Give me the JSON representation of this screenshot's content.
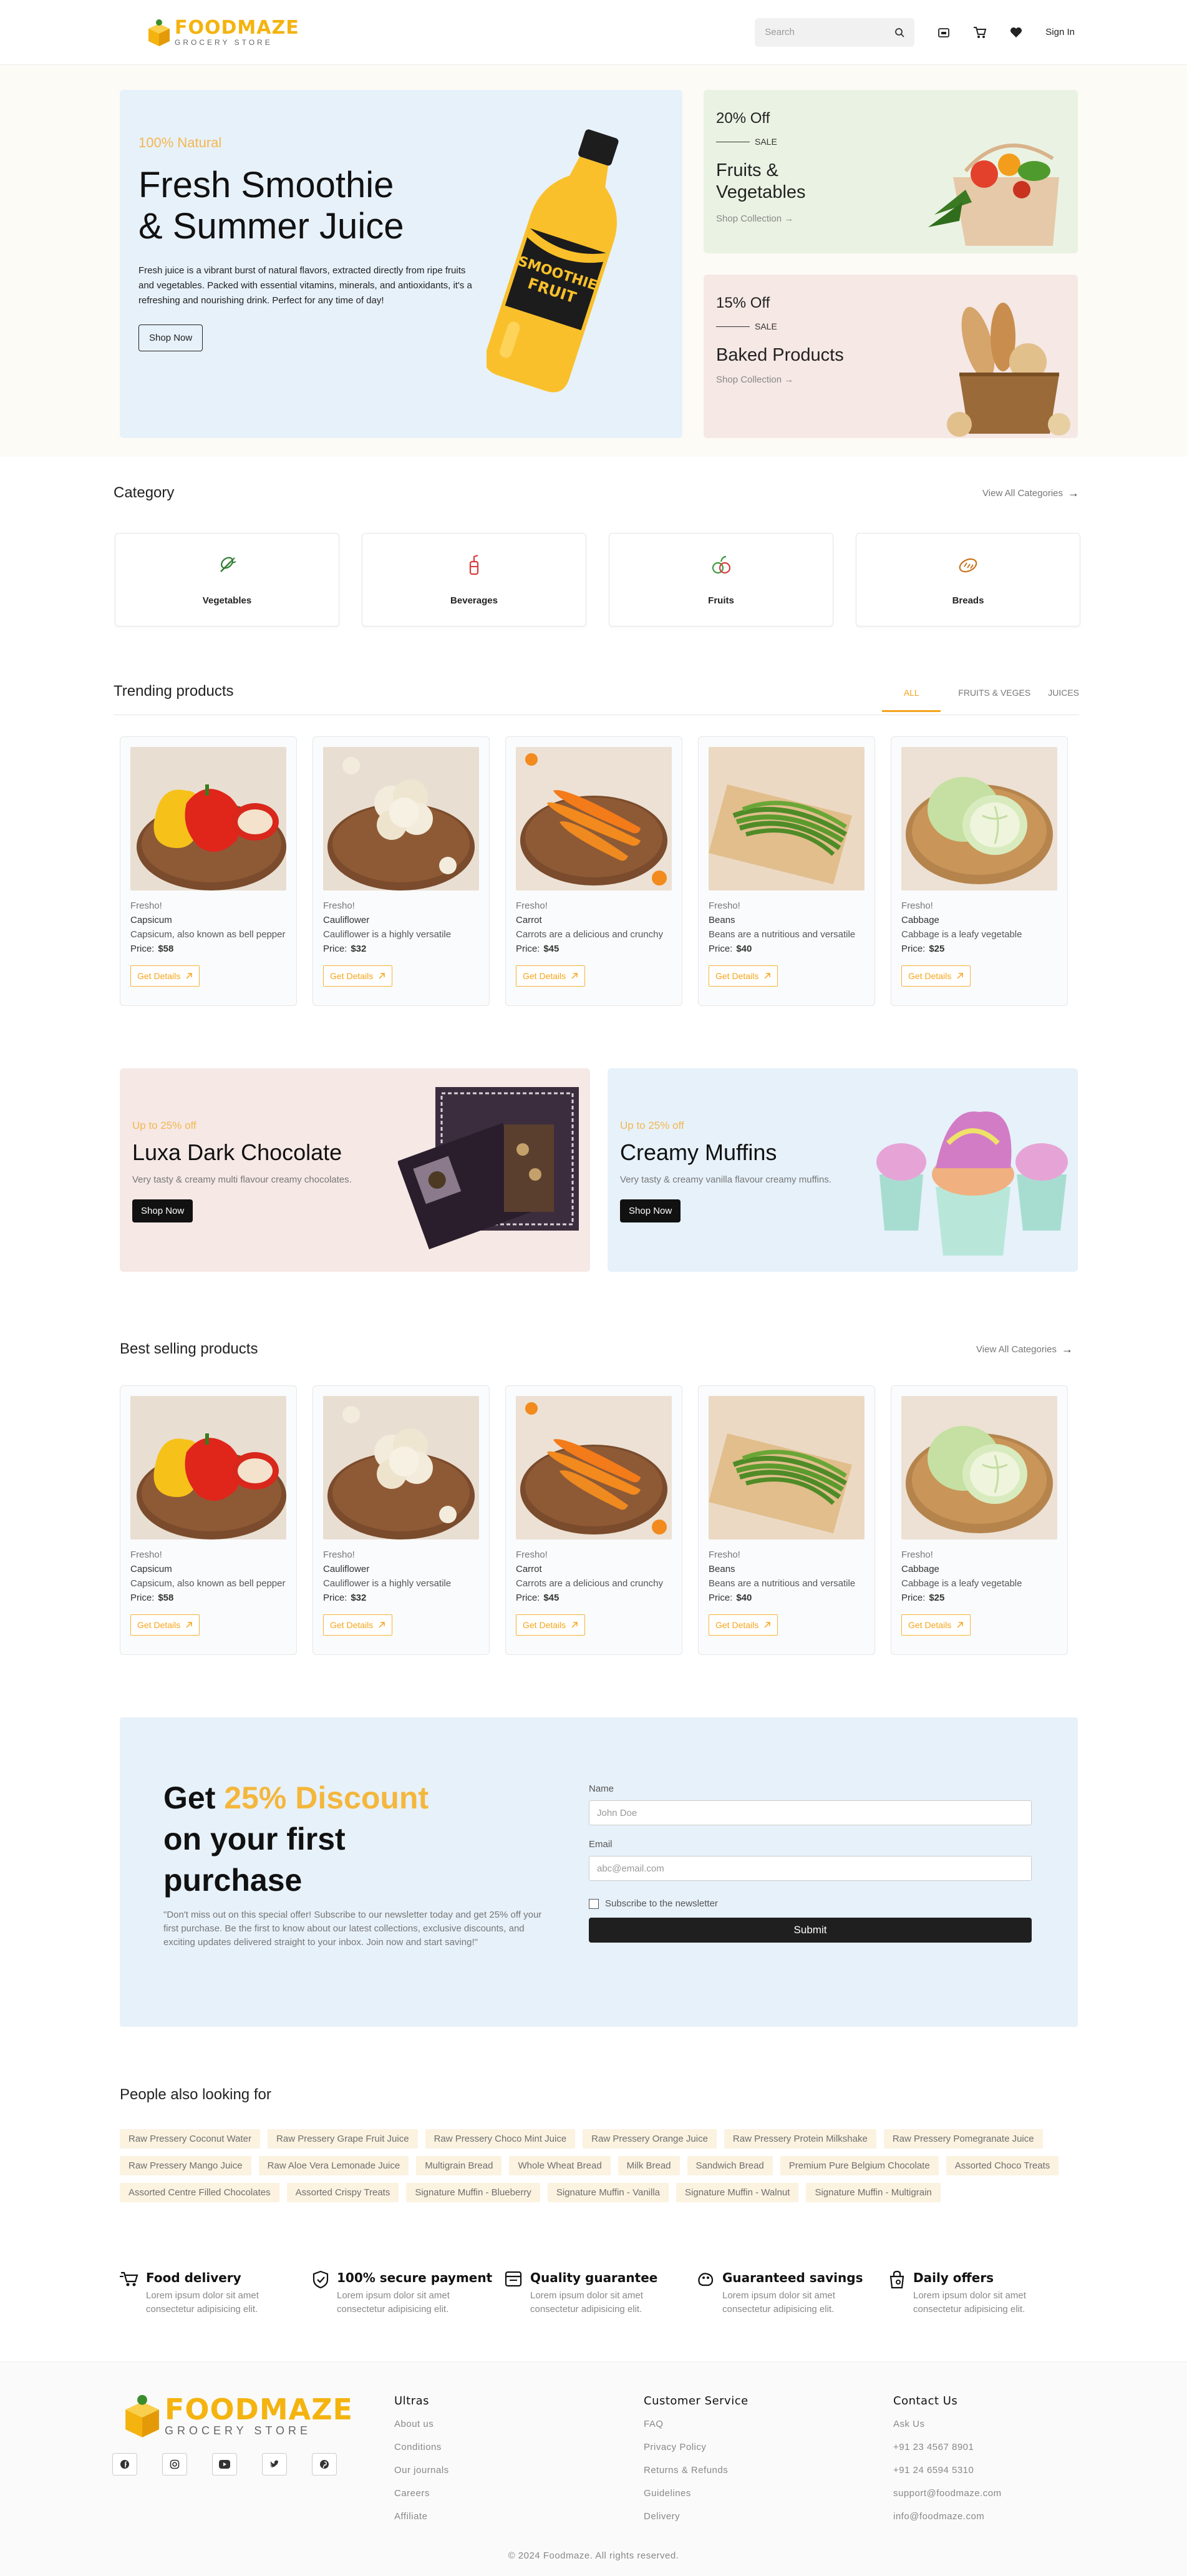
{
  "header": {
    "logo_main_a": "FOOD",
    "logo_main_b": "MAZE",
    "logo_sub": "GROCERY STORE",
    "search_placeholder": "Search",
    "signin": "Sign In"
  },
  "hero": {
    "tag": "100% Natural",
    "title_line1": "Fresh Smoothie",
    "title_line2": "& Summer Juice",
    "desc": "Fresh juice is a vibrant burst of natural flavors, extracted directly from ripe fruits and vegetables. Packed with essential vitamins, minerals, and antioxidants, it's a refreshing and nourishing drink. Perfect for any time of day!",
    "button": "Shop Now",
    "bottle_text1": "SMOOTHIE",
    "bottle_text2": "FRUIT"
  },
  "promos": [
    {
      "off": "20% Off",
      "sale": "SALE",
      "title": "Fruits & Vegetables",
      "link": "Shop Collection"
    },
    {
      "off": "15% Off",
      "sale": "SALE",
      "title": "Baked Products",
      "link": "Shop Collection"
    }
  ],
  "categories": {
    "title": "Category",
    "view_all": "View All Categories",
    "items": [
      {
        "name": "Vegetables",
        "icon": "vegetable-icon"
      },
      {
        "name": "Beverages",
        "icon": "beverage-icon"
      },
      {
        "name": "Fruits",
        "icon": "fruit-icon"
      },
      {
        "name": "Breads",
        "icon": "bread-icon"
      }
    ]
  },
  "trending": {
    "title": "Trending products",
    "tabs": [
      "ALL",
      "FRUITS & VEGES",
      "JUICES"
    ]
  },
  "products": [
    {
      "brand": "Fresho!",
      "name": "Capsicum",
      "desc": "Capsicum, also known as bell pepper",
      "price_label": "Price:",
      "price": "$58",
      "button": "Get Details"
    },
    {
      "brand": "Fresho!",
      "name": "Cauliflower",
      "desc": "Cauliflower is a highly versatile",
      "price_label": "Price:",
      "price": "$32",
      "button": "Get Details"
    },
    {
      "brand": "Fresho!",
      "name": "Carrot",
      "desc": "Carrots are a delicious and crunchy",
      "price_label": "Price:",
      "price": "$45",
      "button": "Get Details"
    },
    {
      "brand": "Fresho!",
      "name": "Beans",
      "desc": "Beans are a nutritious and versatile",
      "price_label": "Price:",
      "price": "$40",
      "button": "Get Details"
    },
    {
      "brand": "Fresho!",
      "name": "Cabbage",
      "desc": "Cabbage is a leafy vegetable",
      "price_label": "Price:",
      "price": "$25",
      "button": "Get Details"
    }
  ],
  "banners": [
    {
      "up": "Up to 25% off",
      "title": "Luxa Dark Chocolate",
      "desc": "Very tasty & creamy multi flavour creamy chocolates.",
      "button": "Shop Now"
    },
    {
      "up": "Up to 25% off",
      "title": "Creamy Muffins",
      "desc": "Very tasty & creamy vanilla flavour creamy muffins.",
      "button": "Shop Now"
    }
  ],
  "best": {
    "title": "Best selling products",
    "view_all": "View All Categories"
  },
  "newsletter": {
    "title_get": "Get ",
    "title_accent": "25% Discount",
    "title_rest1": "on your first",
    "title_rest2": "purchase",
    "desc": "\"Don't miss out on this special offer! Subscribe to our newsletter today and get 25% off your first purchase. Be the first to know about our latest collections, exclusive discounts, and exciting updates delivered straight to your inbox. Join now and start saving!\"",
    "name_label": "Name",
    "name_placeholder": "John Doe",
    "email_label": "Email",
    "email_placeholder": "abc@email.com",
    "checkbox": "Subscribe to the newsletter",
    "submit": "Submit"
  },
  "looking": {
    "title": "People also looking for",
    "chips": [
      "Raw Pressery Coconut Water",
      "Raw Pressery Grape Fruit Juice",
      "Raw Pressery Choco Mint Juice",
      "Raw Pressery Orange Juice",
      "Raw Pressery Protein Milkshake",
      "Raw Pressery Pomegranate Juice",
      "Raw Pressery Mango Juice",
      "Raw Aloe Vera Lemonade Juice",
      "Multigrain Bread",
      "Whole Wheat Bread",
      "Milk Bread",
      "Sandwich Bread",
      "Premium Pure Belgium Chocolate",
      "Assorted Choco Treats",
      "Assorted Centre Filled Chocolates",
      "Assorted Crispy Treats",
      "Signature Muffin - Blueberry",
      "Signature Muffin - Vanilla",
      "Signature Muffin - Walnut",
      "Signature Muffin - Multigrain"
    ]
  },
  "features": [
    {
      "title": "Food delivery",
      "desc": "Lorem ipsum dolor sit amet consectetur adipisicing elit.",
      "icon": "delivery-cart-icon"
    },
    {
      "title": "100% secure payment",
      "desc": "Lorem ipsum dolor sit amet consectetur adipisicing elit.",
      "icon": "shield-check-icon"
    },
    {
      "title": "Quality guarantee",
      "desc": "Lorem ipsum dolor sit amet consectetur adipisicing elit.",
      "icon": "quality-icon"
    },
    {
      "title": "Guaranteed savings",
      "desc": "Lorem ipsum dolor sit amet consectetur adipisicing elit.",
      "icon": "savings-icon"
    },
    {
      "title": "Daily offers",
      "desc": "Lorem ipsum dolor sit amet consectetur adipisicing elit.",
      "icon": "offer-bag-icon"
    }
  ],
  "footer": {
    "logo_a": "FOOD",
    "logo_b": "MAZE",
    "logo_sub": "GROCERY STORE",
    "columns": [
      {
        "title": "Ultras",
        "items": [
          "About us",
          "Conditions",
          "Our journals",
          "Careers",
          "Affiliate"
        ]
      },
      {
        "title": "Customer Service",
        "items": [
          "FAQ",
          "Privacy Policy",
          "Returns & Refunds",
          "Guidelines",
          "Delivery"
        ]
      },
      {
        "title": "Contact Us",
        "items": [
          "Ask Us",
          "+91 23 4567 8901",
          "+91 24 6594 5310",
          "support@foodmaze.com",
          "info@foodmaze.com"
        ]
      }
    ],
    "copyright": "© 2024 Foodmaze. All rights reserved."
  },
  "colors": {
    "accent": "#f4b30f",
    "hero_bg": "#e7f1fa",
    "promo_green": "#eaf3e3",
    "promo_pink": "#f5e8e5"
  }
}
